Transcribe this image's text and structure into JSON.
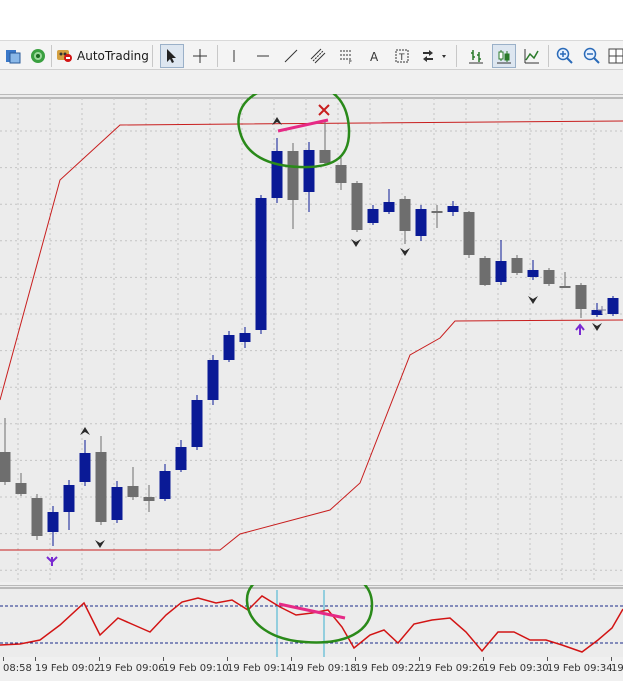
{
  "toolbar": {
    "autotrading_label": "AutoTrading",
    "left_buttons": [
      {
        "name": "accounts-icon"
      },
      {
        "name": "signals-icon"
      }
    ],
    "autotrading_icon": "autotrading-icon",
    "tools": [
      {
        "name": "cursor-icon"
      },
      {
        "name": "crosshair-icon"
      },
      {
        "name": "vertical-line-icon"
      },
      {
        "name": "horizontal-line-icon"
      },
      {
        "name": "trendline-icon"
      },
      {
        "name": "equidistant-channel-icon"
      },
      {
        "name": "fibonacci-icon"
      },
      {
        "name": "text-icon"
      },
      {
        "name": "text-label-icon"
      },
      {
        "name": "arrows-dropdown-icon"
      },
      {
        "name": "bar-chart-icon"
      },
      {
        "name": "candlestick-icon"
      },
      {
        "name": "line-chart-icon"
      },
      {
        "name": "zoom-in-icon"
      },
      {
        "name": "zoom-out-icon"
      },
      {
        "name": "grid-icon"
      }
    ]
  },
  "colors": {
    "bull": "#0a1a96",
    "bear": "#6e6e6e",
    "channel": "#c81e1e",
    "oscillator": "#d21414",
    "annotation": "#2a8a1a",
    "highlight_line": "#e62a86",
    "purple_arrow": "#7a2ad2",
    "cyan_marker": "#3ab0d0"
  },
  "chart_data": [
    {
      "type": "candlestick",
      "candles": [
        {
          "o": 452,
          "h": 418,
          "l": 485,
          "c": 482
        },
        {
          "o": 483,
          "h": 473,
          "l": 496,
          "c": 494
        },
        {
          "o": 498,
          "h": 494,
          "l": 540,
          "c": 536
        },
        {
          "o": 532,
          "h": 506,
          "l": 546,
          "c": 512
        },
        {
          "o": 512,
          "h": 480,
          "l": 530,
          "c": 485
        },
        {
          "o": 482,
          "h": 440,
          "l": 486,
          "c": 453
        },
        {
          "o": 452,
          "h": 436,
          "l": 525,
          "c": 522
        },
        {
          "o": 520,
          "h": 481,
          "l": 523,
          "c": 487
        },
        {
          "o": 486,
          "h": 467,
          "l": 500,
          "c": 497
        },
        {
          "o": 497,
          "h": 485,
          "l": 512,
          "c": 501
        },
        {
          "o": 499,
          "h": 464,
          "l": 501,
          "c": 471
        },
        {
          "o": 470,
          "h": 440,
          "l": 472,
          "c": 447
        },
        {
          "o": 447,
          "h": 395,
          "l": 450,
          "c": 400
        },
        {
          "o": 400,
          "h": 355,
          "l": 405,
          "c": 360
        },
        {
          "o": 360,
          "h": 331,
          "l": 362,
          "c": 335
        },
        {
          "o": 342,
          "h": 327,
          "l": 348,
          "c": 333
        },
        {
          "o": 330,
          "h": 195,
          "l": 334,
          "c": 198
        },
        {
          "o": 198,
          "h": 138,
          "l": 203,
          "c": 151
        },
        {
          "o": 151,
          "h": 143,
          "l": 229,
          "c": 200
        },
        {
          "o": 192,
          "h": 142,
          "l": 212,
          "c": 150
        },
        {
          "o": 150,
          "h": 122,
          "l": 165,
          "c": 163
        },
        {
          "o": 165,
          "h": 155,
          "l": 190,
          "c": 183
        },
        {
          "o": 183,
          "h": 181,
          "l": 232,
          "c": 230
        },
        {
          "o": 223,
          "h": 205,
          "l": 225,
          "c": 209
        },
        {
          "o": 212,
          "h": 189,
          "l": 214,
          "c": 202
        },
        {
          "o": 199,
          "h": 196,
          "l": 244,
          "c": 231
        },
        {
          "o": 236,
          "h": 205,
          "l": 241,
          "c": 209
        },
        {
          "o": 211,
          "h": 205,
          "l": 228,
          "c": 212
        },
        {
          "o": 212,
          "h": 201,
          "l": 216,
          "c": 206
        },
        {
          "o": 212,
          "h": 211,
          "l": 258,
          "c": 255
        },
        {
          "o": 258,
          "h": 256,
          "l": 286,
          "c": 285
        },
        {
          "o": 282,
          "h": 240,
          "l": 285,
          "c": 261
        },
        {
          "o": 258,
          "h": 255,
          "l": 275,
          "c": 273
        },
        {
          "o": 277,
          "h": 260,
          "l": 280,
          "c": 270
        },
        {
          "o": 270,
          "h": 268,
          "l": 286,
          "c": 284
        },
        {
          "o": 286,
          "h": 272,
          "l": 288,
          "c": 287
        },
        {
          "o": 285,
          "h": 283,
          "l": 318,
          "c": 309
        },
        {
          "o": 315,
          "h": 303,
          "l": 317,
          "c": 310
        },
        {
          "o": 314,
          "h": 296,
          "l": 316,
          "c": 298
        }
      ],
      "channel_upper": [
        [
          0,
          400
        ],
        [
          60,
          180
        ],
        [
          120,
          125
        ],
        [
          623,
          121
        ]
      ],
      "channel_lower": [
        [
          0,
          550
        ],
        [
          220,
          550
        ],
        [
          240,
          534
        ],
        [
          330,
          510
        ],
        [
          360,
          483
        ],
        [
          410,
          355
        ],
        [
          440,
          338
        ],
        [
          455,
          321
        ],
        [
          623,
          320
        ]
      ]
    },
    {
      "type": "line",
      "series": [
        {
          "values": [
            [
              0,
              645
            ],
            [
              20,
              644
            ],
            [
              40,
              640
            ],
            [
              60,
              625
            ],
            [
              84,
              603
            ],
            [
              100,
              635
            ],
            [
              118,
              618
            ],
            [
              134,
              625
            ],
            [
              150,
              632
            ],
            [
              166,
              615
            ],
            [
              182,
              602
            ],
            [
              198,
              598
            ],
            [
              216,
              603
            ],
            [
              232,
              600
            ],
            [
              248,
              610
            ],
            [
              262,
              596
            ],
            [
              280,
              607
            ],
            [
              296,
              615
            ],
            [
              312,
              613
            ],
            [
              328,
              610
            ],
            [
              342,
              627
            ],
            [
              354,
              648
            ],
            [
              370,
              635
            ],
            [
              384,
              630
            ],
            [
              398,
              643
            ],
            [
              414,
              624
            ],
            [
              432,
              620
            ],
            [
              450,
              618
            ],
            [
              466,
              632
            ],
            [
              482,
              651
            ],
            [
              498,
              632
            ],
            [
              514,
              632
            ],
            [
              530,
              640
            ],
            [
              546,
              640
            ],
            [
              562,
              645
            ],
            [
              582,
              652
            ],
            [
              598,
              640
            ],
            [
              612,
              628
            ],
            [
              623,
              609
            ]
          ]
        }
      ],
      "levels": [
        606,
        643
      ]
    }
  ],
  "xaxis": {
    "labels": [
      "08:58",
      "19 Feb 09:02",
      "19 Feb 09:06",
      "19 Feb 09:10",
      "19 Feb 09:14",
      "19 Feb 09:18",
      "19 Feb 09:22",
      "19 Feb 09:26",
      "19 Feb 09:30",
      "19 Feb 09:34",
      "19"
    ]
  }
}
